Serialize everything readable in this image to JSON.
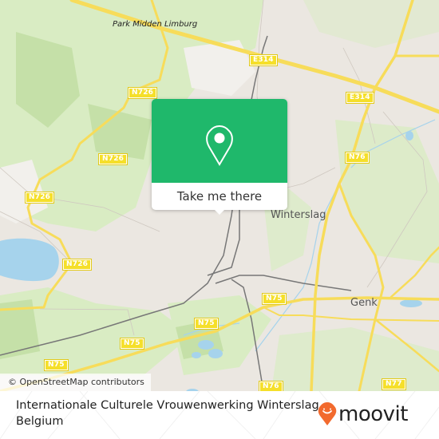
{
  "map": {
    "attribution": "© OpenStreetMap contributors",
    "place_labels": {
      "park": "Park Midden Limburg",
      "winterslag": "Winterslag",
      "genk": "Genk"
    },
    "road_labels": {
      "e314_a": "E314",
      "e314_b": "E314",
      "n726_a": "N726",
      "n726_b": "N726",
      "n726_c": "N726",
      "n726_d": "N726",
      "n76_a": "N76",
      "n76_b": "N76",
      "n75_a": "N75",
      "n75_b": "N75",
      "n75_c": "N75",
      "n75_d": "N75",
      "n77": "N77"
    },
    "colors": {
      "land": "#ebe7e1",
      "green": "#d9ecc3",
      "water": "#a6d3ec",
      "road": "#f7dc5a",
      "rail": "#777777"
    }
  },
  "popup": {
    "icon": "map-pin-icon",
    "cta_label": "Take me there",
    "color": "#1fb86b"
  },
  "footer": {
    "location_title": "Internationale Culturele Vrouwenwerking Winterslag, Belgium",
    "brand": "moovit",
    "brand_icon": "moovit-pin-smile-icon",
    "brand_color": "#f26a2e"
  }
}
